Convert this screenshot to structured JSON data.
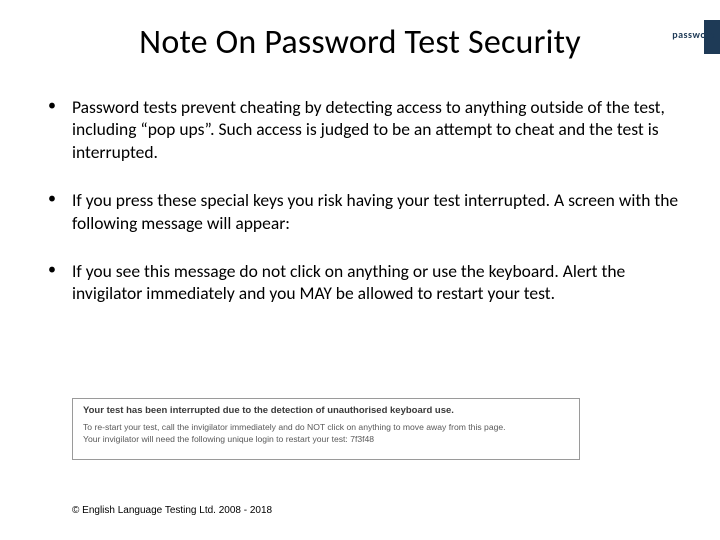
{
  "logo": {
    "text": "password"
  },
  "title": "Note On Password Test Security",
  "bullets": [
    "Password tests prevent cheating by detecting access to anything outside of the test, including “pop ups”.  Such access is judged to be an attempt to cheat and the test is interrupted.",
    "If you press these special keys you risk having your test interrupted. A screen with the following message will appear:",
    "If you see this message do not click on anything or use the keyboard. Alert the invigilator immediately and you MAY be allowed to restart your test."
  ],
  "message_box": {
    "headline": "Your test has been interrupted due to the detection of unauthorised keyboard use.",
    "line1": "To re-start your test, call the invigilator immediately and do NOT click on anything to move away from this page.",
    "line2": "Your invigilator will need the following unique login to restart your test: 7f3f48"
  },
  "copyright": "© English Language Testing Ltd. 2008 - 2018"
}
